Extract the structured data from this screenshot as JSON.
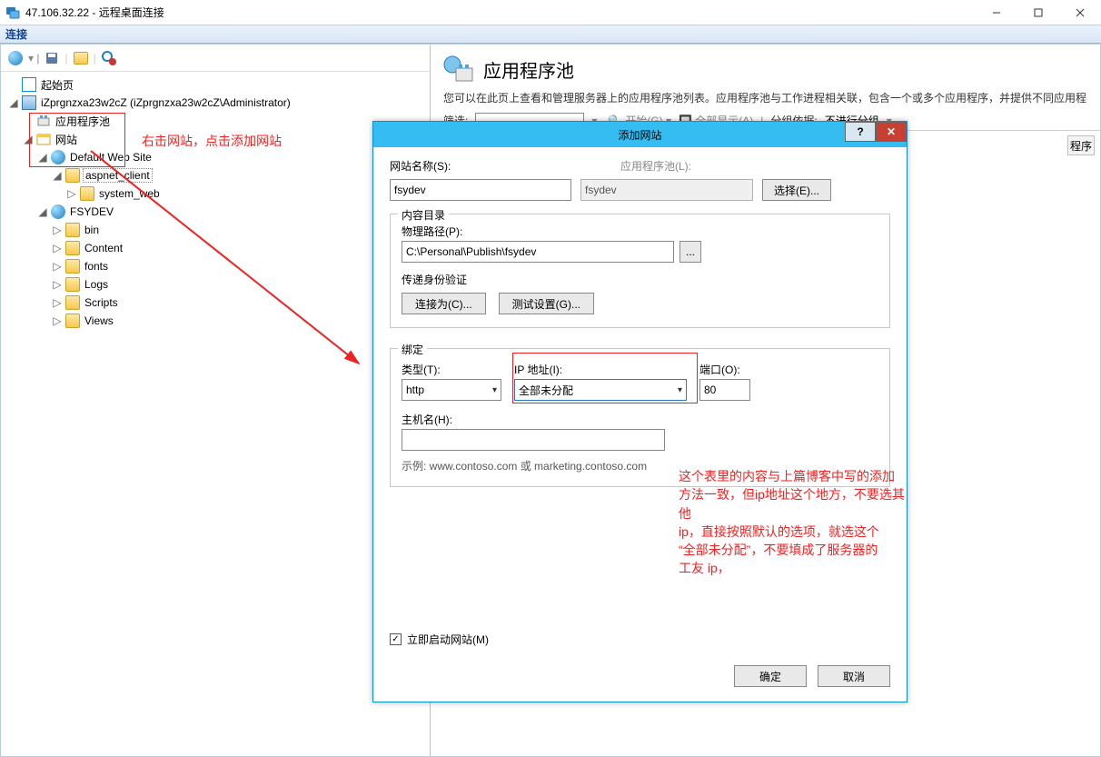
{
  "window": {
    "title": "47.106.32.22 - 远程桌面连接"
  },
  "connbar": {
    "label": "连接"
  },
  "tree": {
    "start": "起始页",
    "server": "iZprgnzxa23w2cZ (iZprgnzxa23w2cZ\\Administrator)",
    "apppool": "应用程序池",
    "sites": "网站",
    "default": "Default Web Site",
    "aspnet": "aspnet_client",
    "systemweb": "system_web",
    "fsydev": "FSYDEV",
    "bin": "bin",
    "content": "Content",
    "fonts": "fonts",
    "logs": "Logs",
    "scripts": "Scripts",
    "views": "Views"
  },
  "annotation1": "右击网站，点击添加网站",
  "rightpane": {
    "title": "应用程序池",
    "desc": "您可以在此页上查看和管理服务器上的应用程序池列表。应用程序池与工作进程相关联，包含一个或多个应用程序，并提供不同应用程",
    "filterLabel": "筛选:",
    "go": "开始(G)",
    "showall": "全部显示(A)",
    "groupLabel": "分组依据:",
    "groupValue": "不进行分组",
    "detailTab": "程序"
  },
  "dialog": {
    "title": "添加网站",
    "siteNameLabel": "网站名称(S):",
    "siteNameValue": "fsydev",
    "apppoolLabel": "应用程序池(L):",
    "apppoolValue": "fsydev",
    "selectBtn": "选择(E)...",
    "contentGroup": "内容目录",
    "physPathLabel": "物理路径(P):",
    "physPathValue": "C:\\Personal\\Publish\\fsydev",
    "browse": "...",
    "passAuthLabel": "传递身份验证",
    "connectAs": "连接为(C)...",
    "testSettings": "测试设置(G)...",
    "bindingGroup": "绑定",
    "typeLabel": "类型(T):",
    "typeValue": "http",
    "ipLabel": "IP 地址(I):",
    "ipValue": "全部未分配",
    "portLabel": "端口(O):",
    "portValue": "80",
    "hostLabel": "主机名(H):",
    "hostValue": "",
    "example": "示例: www.contoso.com 或 marketing.contoso.com",
    "autoStart": "立即启动网站(M)",
    "ok": "确定",
    "cancel": "取消"
  },
  "annotation2": "这个表里的内容与上篇博客中写的添加\n方法一致，但ip地址这个地方，不要选其他\nip，直接按照默认的选项，就选这个\n“全部未分配”，不要填成了服务器的\n工友 ip，"
}
